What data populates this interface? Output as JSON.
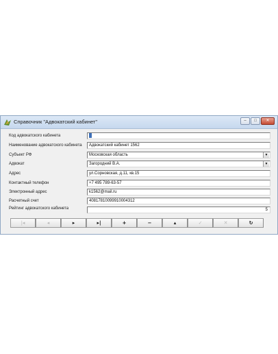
{
  "window": {
    "title": "Справочник \"Адвокатский кабинет\"",
    "controls": [
      "minimize-icon",
      "maximize-icon",
      "close-icon"
    ]
  },
  "form": {
    "fields": [
      {
        "label": "Код адвокатского кабинета",
        "value": "",
        "type": "text"
      },
      {
        "label": "Наименование адвокатского кабинета",
        "value": "Адвокатский кабинет 1562",
        "type": "text"
      },
      {
        "label": "Субъект РФ",
        "value": "Московская область",
        "type": "select"
      },
      {
        "label": "Адвокат",
        "value": "Загородний В.А.",
        "type": "select"
      },
      {
        "label": "Адрес",
        "value": "ул.Сорновская, д.11, кв.15",
        "type": "text"
      },
      {
        "label": "Контактный телефон",
        "value": "+7 495 789-63-57",
        "type": "text"
      },
      {
        "label": "Электронный адрес",
        "value": "k1562@mail.ru",
        "type": "text"
      },
      {
        "label": "Расчетный счет",
        "value": "40817810099910004312",
        "type": "text"
      },
      {
        "label": "Рейтинг адвокатского кабинета",
        "value": "5",
        "type": "number"
      }
    ]
  },
  "navigator": {
    "buttons": [
      {
        "name": "first-record-button",
        "glyph": "|◂",
        "enabled": false
      },
      {
        "name": "prior-record-button",
        "glyph": "◂",
        "enabled": false
      },
      {
        "name": "next-record-button",
        "glyph": "▸",
        "enabled": true
      },
      {
        "name": "last-record-button",
        "glyph": "▸|",
        "enabled": true
      },
      {
        "name": "insert-record-button",
        "glyph": "+",
        "enabled": true
      },
      {
        "name": "delete-record-button",
        "glyph": "−",
        "enabled": true
      },
      {
        "name": "edit-record-button",
        "glyph": "▴",
        "enabled": true
      },
      {
        "name": "post-record-button",
        "glyph": "✓",
        "enabled": false
      },
      {
        "name": "cancel-edit-button",
        "glyph": "✕",
        "enabled": false
      },
      {
        "name": "refresh-button",
        "glyph": "↻",
        "enabled": true
      }
    ]
  }
}
